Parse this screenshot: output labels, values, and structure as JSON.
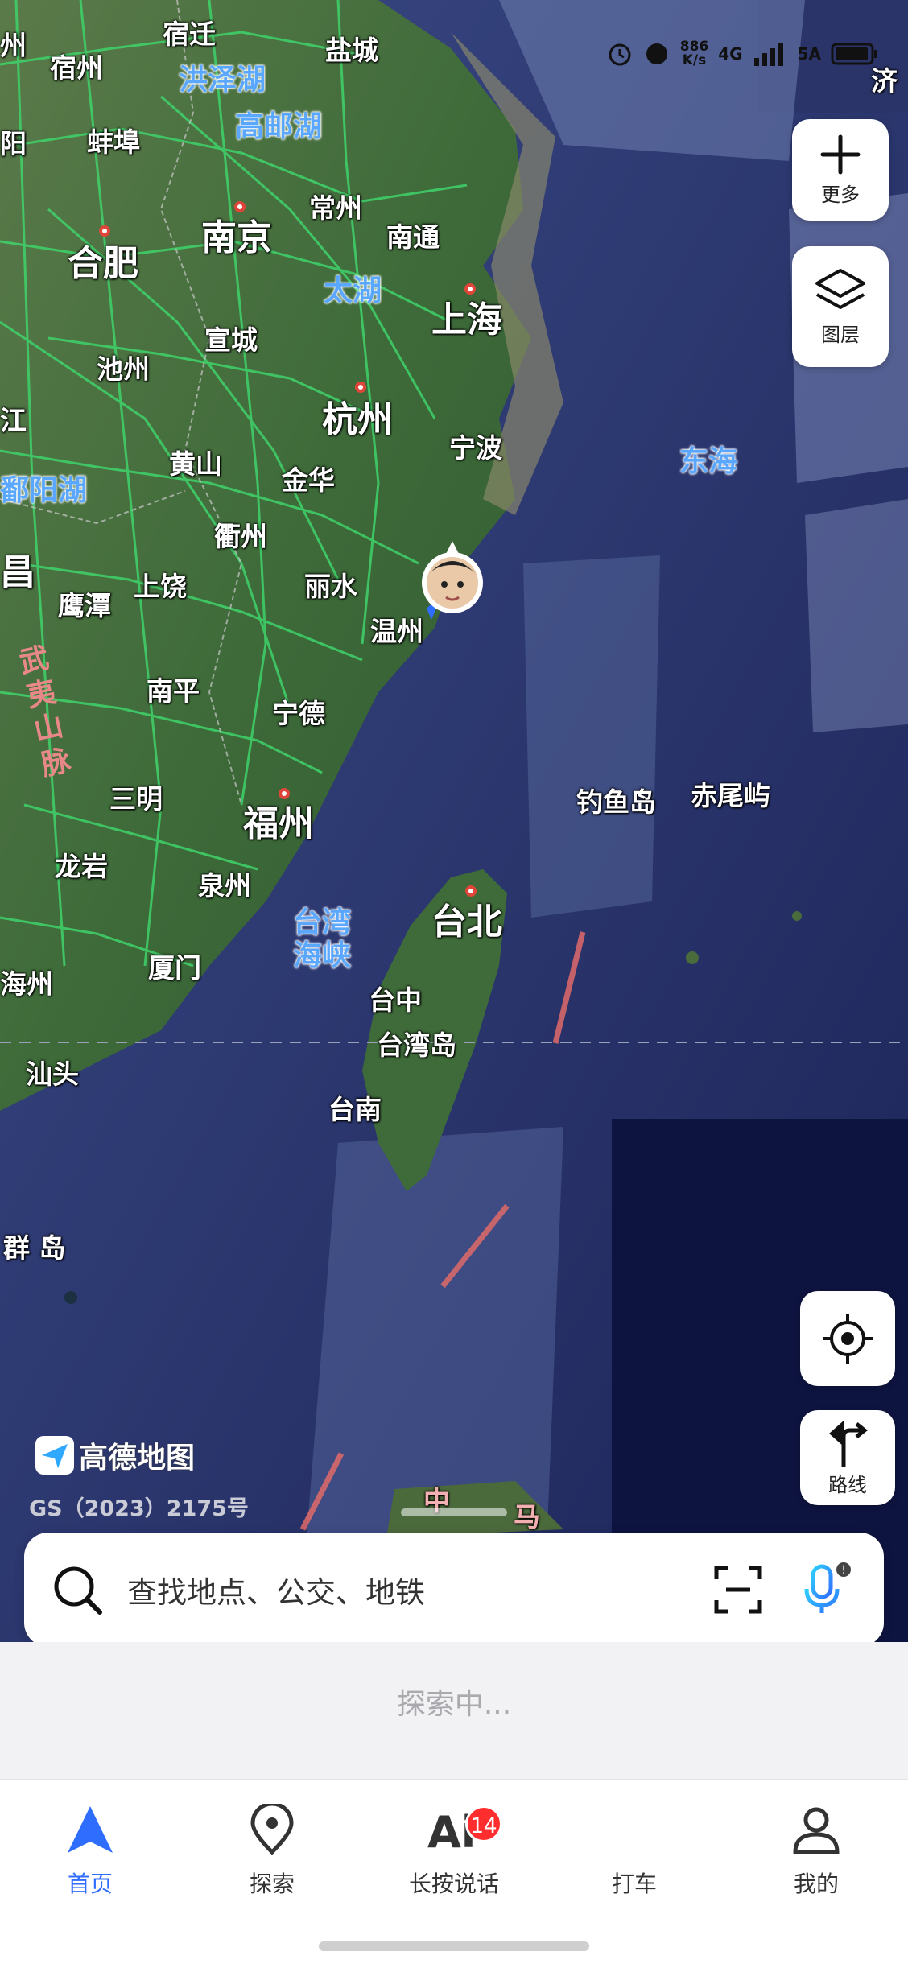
{
  "status_bar": {
    "net_speed_value": "886",
    "net_speed_unit": "K/s",
    "net_type": "4G",
    "net_type_2": "5A"
  },
  "map": {
    "cities_large": [
      "合肥",
      "南京",
      "上海",
      "杭州",
      "福州",
      "台北"
    ],
    "cities_medium": [
      "宿州",
      "宿迁",
      "盐城",
      "蚌埠",
      "常州",
      "南通",
      "池州",
      "宣城",
      "宁波",
      "黄山",
      "金华",
      "衢州",
      "丽水",
      "温州",
      "鹰潭",
      "上饶",
      "南平",
      "宁德",
      "三明",
      "龙岩",
      "泉州",
      "厦门",
      "汕头",
      "台中",
      "台湾岛",
      "台南",
      "钓鱼岛",
      "赤尾屿",
      "群 岛"
    ],
    "waters": [
      "洪泽湖",
      "高邮湖",
      "太湖",
      "东海",
      "鄱阳湖",
      "台湾海峡"
    ],
    "mountain": "武夷山脉",
    "edge_fragments": [
      "济",
      "江",
      "昌",
      "海州",
      "阳",
      "州"
    ],
    "bottom_fragment": [
      "中",
      "马"
    ]
  },
  "controls": {
    "more_label": "更多",
    "layers_label": "图层",
    "route_label": "路线"
  },
  "branding": {
    "logo_text": "高德地图",
    "license": "GS（2023）2175号"
  },
  "search": {
    "placeholder": "查找地点、公交、地铁"
  },
  "explore": {
    "status": "探索中..."
  },
  "tabs": [
    {
      "label": "首页",
      "icon": "nav-arrow-icon",
      "active": true
    },
    {
      "label": "探索",
      "icon": "location-pin-icon",
      "active": false
    },
    {
      "label": "长按说话",
      "icon": "ai-icon",
      "badge": "14",
      "active": false
    },
    {
      "label": "打车",
      "icon": "taxi-icon",
      "active": false
    },
    {
      "label": "我的",
      "icon": "profile-icon",
      "active": false
    }
  ],
  "colors": {
    "accent": "#2f6dff",
    "badge": "#ff2d2d",
    "land": "#3d6b3a",
    "sea": "#2a3570"
  }
}
